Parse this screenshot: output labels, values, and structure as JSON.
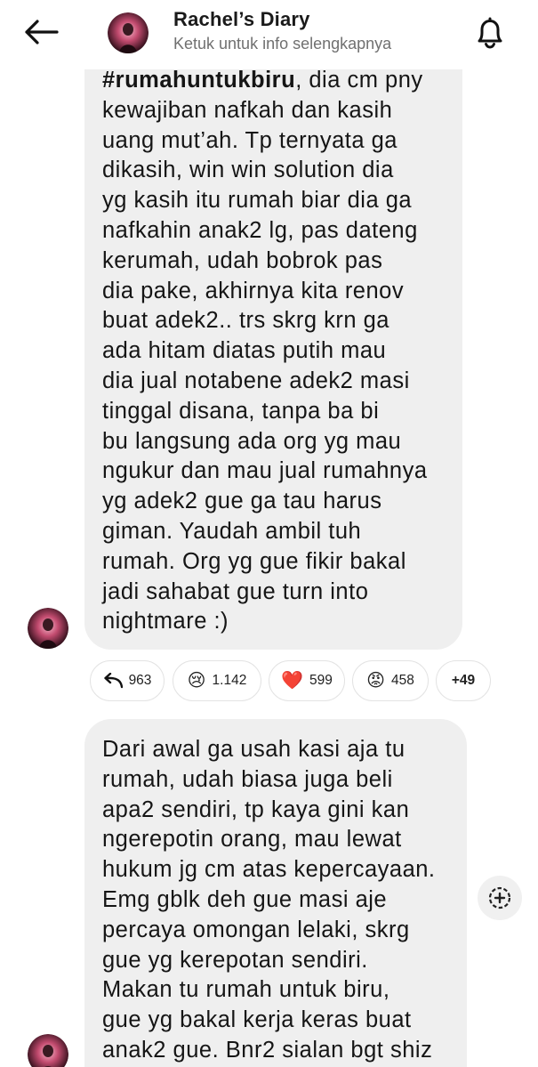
{
  "header": {
    "title": "Rachel’s Diary",
    "subtitle": "Ketuk untuk info selengkapnya",
    "back_icon": "arrow-left-icon",
    "bell_icon": "bell-icon"
  },
  "messages": [
    {
      "hashtag": "#rumahuntukbiru",
      "first_line_rest": ", dia cm pny",
      "lines": [
        "kewajiban nafkah dan kasih",
        "uang mut’ah. Tp ternyata ga",
        "dikasih, win win solution dia",
        "yg kasih itu rumah biar dia ga",
        "nafkahin anak2 lg, pas dateng",
        "kerumah, udah bobrok pas",
        "dia pake, akhirnya kita renov",
        "buat adek2.. trs skrg krn ga",
        "ada hitam diatas putih mau",
        "dia jual notabene adek2 masi",
        "tinggal disana, tanpa ba bi",
        "bu langsung ada org yg mau",
        "ngukur dan mau jual rumahnya",
        "yg adek2 gue ga tau harus",
        "giman. Yaudah ambil tuh",
        "rumah. Org yg gue fikir bakal",
        "jadi sahabat gue turn into",
        "nightmare :)"
      ]
    },
    {
      "lines": [
        "Dari awal ga usah kasi aja tu",
        "rumah, udah biasa juga beli",
        "apa2 sendiri, tp kaya gini kan",
        "ngerepotin orang, mau lewat",
        "hukum jg cm atas kepercayaan.",
        "Emg gblk deh gue masi aje",
        "percaya omongan lelaki, skrg",
        "gue yg kerepotan sendiri.",
        "Makan tu rumah untuk biru,",
        "gue yg bakal kerja keras buat",
        "anak2 gue. Bnr2 sialan bgt shiz"
      ]
    }
  ],
  "reactions": [
    {
      "icon": "reply-arrow-icon",
      "emoji": "",
      "count": "963"
    },
    {
      "icon": "crying-face-icon",
      "emoji": "😢",
      "count": "1.142"
    },
    {
      "icon": "red-heart-icon",
      "emoji": "❤️",
      "count": "599"
    },
    {
      "icon": "angry-face-icon",
      "emoji": "😡",
      "count": "458"
    },
    {
      "icon": "",
      "emoji": "",
      "count": "+49"
    }
  ],
  "add_reaction_icon": "add-reaction-icon",
  "colors": {
    "bubble": "#efefef",
    "heart": "#e0245e",
    "subtitle": "#707070"
  }
}
